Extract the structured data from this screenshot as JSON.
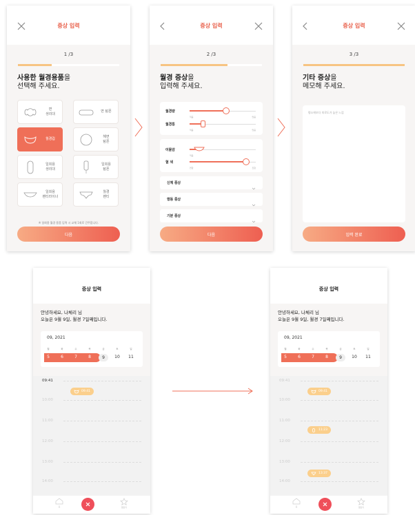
{
  "screen1": {
    "title": "증상 입력",
    "step": "1 /3",
    "progress": 0.33,
    "heading_bold": "사용한 월경용품",
    "heading_bold_suffix": "을",
    "heading_line2": "선택해 주세요.",
    "products": [
      {
        "label": "면\n생리대",
        "selected": false
      },
      {
        "label": "면 탐폰",
        "selected": false
      },
      {
        "label": "월경컵",
        "selected": true
      },
      {
        "label": "해면\n탐폰",
        "selected": false
      },
      {
        "label": "일회용\n생리대",
        "selected": false
      },
      {
        "label": "일회용\n탐폰",
        "selected": false
      },
      {
        "label": "일회용\n팬티라이너",
        "selected": false
      },
      {
        "label": "월경\n팬티",
        "selected": false
      }
    ],
    "note": "※ 일회용 월경 용품 입력 시 교체 1회로 간주합니다.",
    "button": "다음"
  },
  "screen2": {
    "title": "증상 입력",
    "step": "2 /3",
    "progress": 0.66,
    "heading_bold": "월경 증상",
    "heading_bold_suffix": "을",
    "heading_line2": "입력해 주세요.",
    "sliders": [
      {
        "label": "월경량",
        "value": 0.55,
        "min": "적음",
        "max": "많음"
      },
      {
        "label": "월경통",
        "value": 0.2,
        "min": "적음",
        "max": "많음"
      },
      {
        "label": "이물감",
        "value": 0.15,
        "min": "적음",
        "max": "많음"
      },
      {
        "label": "혈 색",
        "value": 0.85,
        "min": "연함",
        "max": "진함"
      }
    ],
    "sections": [
      "신체 증상",
      "행동 증상",
      "기분 증상"
    ],
    "button": "다음"
  },
  "screen3": {
    "title": "증상 입력",
    "step": "3 /3",
    "progress": 1.0,
    "heading_bold": "기타 증상",
    "heading_bold_suffix": "을",
    "heading_line2": "메모해 주세요.",
    "memo_placeholder": "평소에보다 피로도가 높은 느낌",
    "button": "입력 완료"
  },
  "home": {
    "title": "증상 입력",
    "greeting_line1": "안녕하세요, 나체리 님",
    "greeting_line2": "오늘은 9월 9일, 월경 7일째입니다.",
    "month": "09, 2021",
    "weekdays": [
      "월",
      "화",
      "수",
      "목",
      "금",
      "토",
      "일"
    ],
    "dates": [
      "5",
      "6",
      "7",
      "8",
      "9",
      "10",
      "11"
    ],
    "period_dates": 4,
    "current_date": "9",
    "times": [
      "09:41",
      "10:00",
      "11:00",
      "12:00",
      "13:00",
      "14:00"
    ],
    "tabs": [
      "홈",
      "캘린더"
    ]
  },
  "home_before": {
    "entries": [
      {
        "time": "09:41"
      }
    ]
  },
  "home_after": {
    "entries": [
      {
        "time": "09:41"
      },
      {
        "time": "11:23"
      },
      {
        "time": "13:37"
      }
    ]
  },
  "colors": {
    "accent": "#ef6f58",
    "chip": "#fbcf8c",
    "fab": "#ef4f5a"
  }
}
